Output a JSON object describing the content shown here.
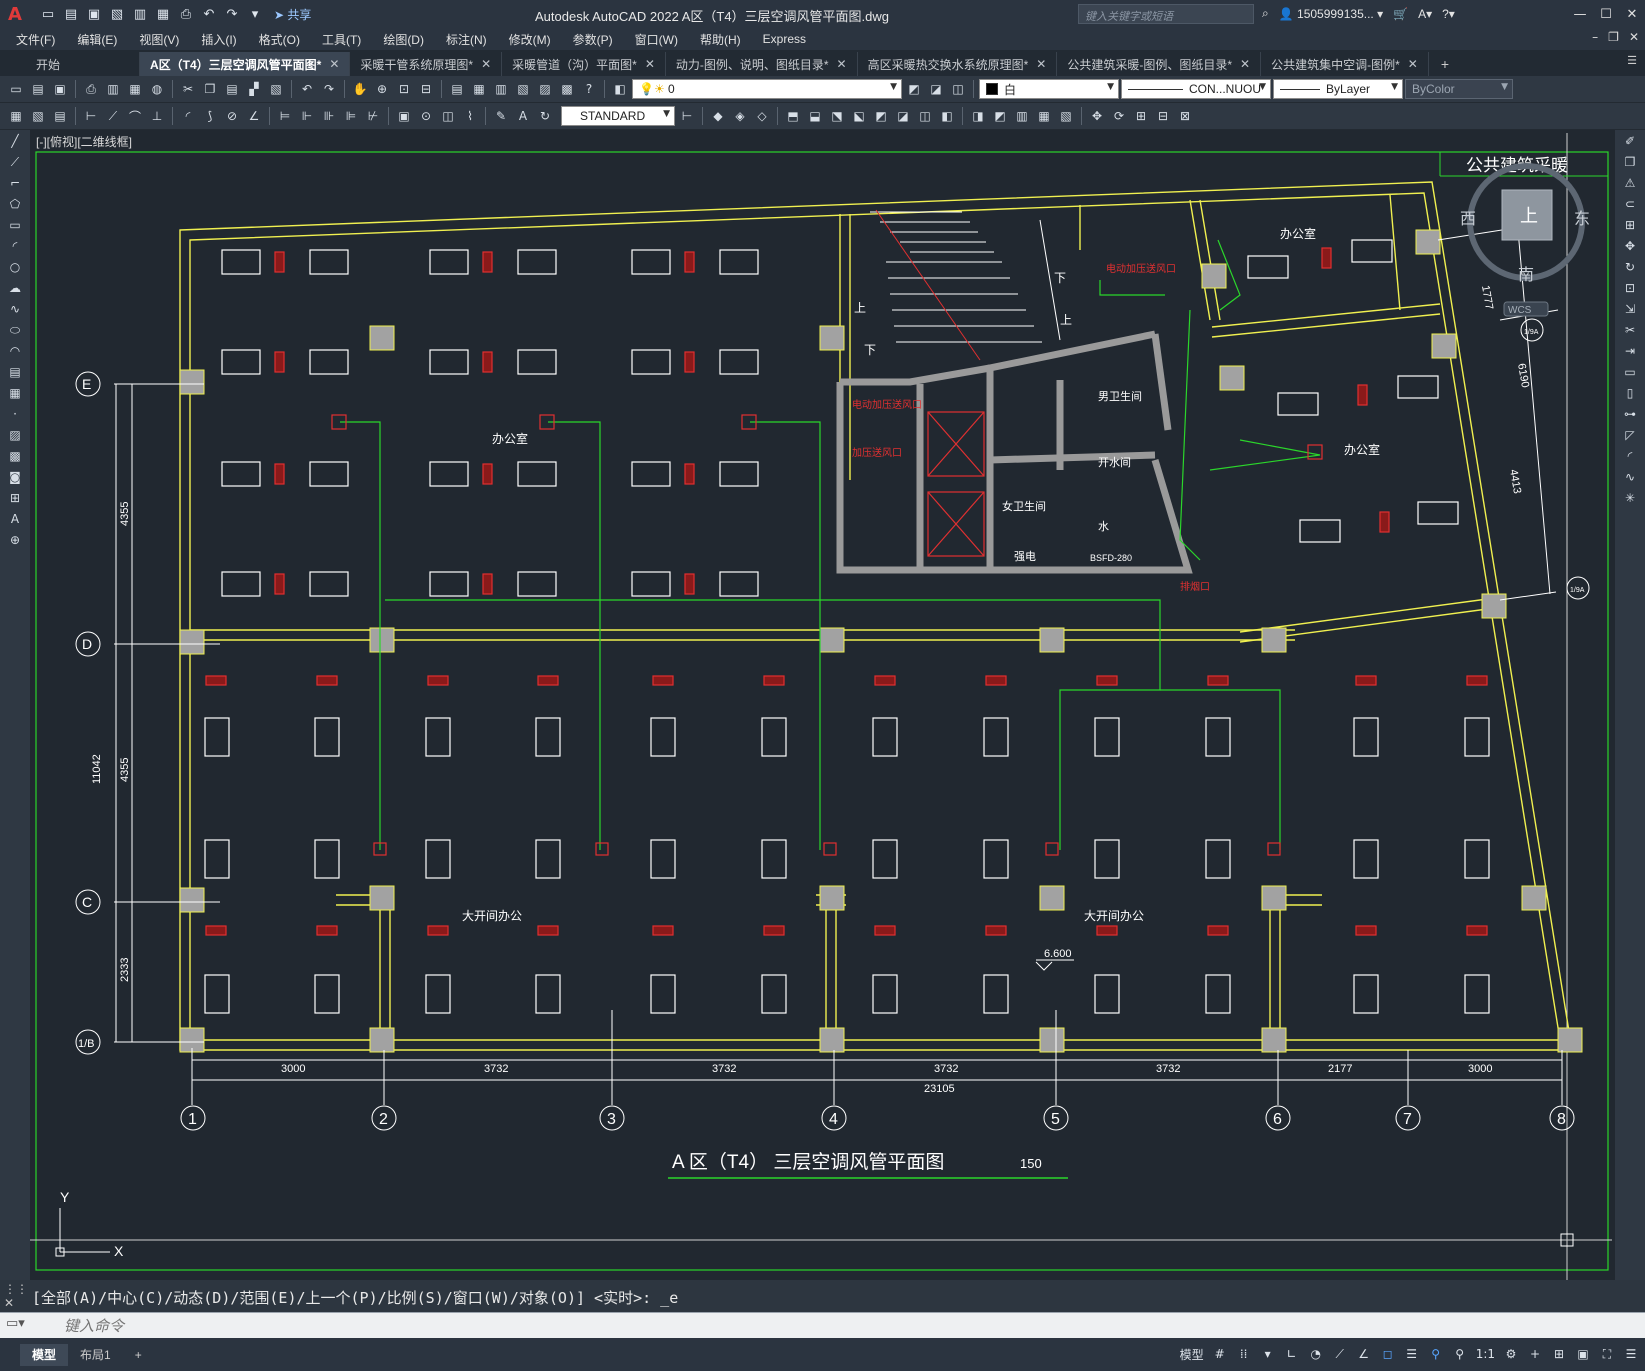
{
  "app": {
    "logo": "A",
    "share_label": "共享",
    "title": "Autodesk AutoCAD 2022    A区（T4）三层空调风管平面图.dwg",
    "search_placeholder": "键入关键字或短语",
    "user": "1505999135...",
    "window_controls": [
      "—",
      "☐",
      "✕"
    ]
  },
  "menus": [
    "文件(F)",
    "编辑(E)",
    "视图(V)",
    "插入(I)",
    "格式(O)",
    "工具(T)",
    "绘图(D)",
    "标注(N)",
    "修改(M)",
    "参数(P)",
    "窗口(W)",
    "帮助(H)",
    "Express"
  ],
  "tabs": [
    {
      "label": "开始",
      "closable": false,
      "active": false
    },
    {
      "label": "A区（T4）三层空调风管平面图*",
      "closable": true,
      "active": true
    },
    {
      "label": "采暖干管系统原理图*",
      "closable": true,
      "active": false
    },
    {
      "label": "采暖管道（沟）平面图*",
      "closable": true,
      "active": false
    },
    {
      "label": "动力-图例、说明、图纸目录*",
      "closable": true,
      "active": false
    },
    {
      "label": "高区采暖热交换水系统原理图*",
      "closable": true,
      "active": false
    },
    {
      "label": "公共建筑采暖-图例、图纸目录*",
      "closable": true,
      "active": false
    },
    {
      "label": "公共建筑集中空调-图例*",
      "closable": true,
      "active": false
    }
  ],
  "toolbar": {
    "layer": "0",
    "color": "白",
    "linetype": "CON...NUOU",
    "lineweight": "ByLayer",
    "plotstyle": "ByColor",
    "textstyle": "STANDARD"
  },
  "viewport_label": "[-][俯视][二维线框]",
  "viewcube": {
    "top": "上",
    "west": "西",
    "east": "东",
    "south": "南",
    "wcs": "WCS"
  },
  "drawing": {
    "title_block": "公共建筑采暖",
    "drawing_title": "A 区（T4）    三层空调风管平面图",
    "scale_suffix": "150",
    "rooms": {
      "office_upper_left": "办公室",
      "office_upper_right_a": "办公室",
      "office_upper_right_b": "办公室",
      "open_office_left": "大开间办公",
      "open_office_right": "大开间办公",
      "male_wc": "男卫生间",
      "female_wc": "女卫生间",
      "water_room": "开水间",
      "elec": "强电",
      "water": "水",
      "stair_up_1": "上",
      "stair_down_1": "下",
      "stair_up_2": "上",
      "stair_down_2": "下"
    },
    "red_notes": {
      "pressure_a": "电动加压送风口",
      "pressure_b": "电动加压送风口",
      "pressure_c": "加压送风口",
      "exhaust": "排烟口"
    },
    "fire_damper": "BSFD-280",
    "elevation": "6.600",
    "axes_h": [
      "1",
      "2",
      "3",
      "4",
      "5",
      "6",
      "7",
      "8"
    ],
    "axes_v": [
      "E",
      "D",
      "C",
      "1/B"
    ],
    "dims_h": [
      "3000",
      "3732",
      "3732",
      "3732",
      "3732",
      "2177",
      "3000"
    ],
    "dim_total": "23105",
    "dims_v": [
      "4355",
      "4355",
      "2333"
    ],
    "dim_v_total": "11042",
    "dims_right": [
      "1777",
      "6190",
      "4413"
    ],
    "axis_bubbles_right": [
      "1/9A",
      "1/9A"
    ],
    "ucs": {
      "y": "Y",
      "x": "X"
    }
  },
  "command": {
    "history": "[全部(A)/中心(C)/动态(D)/范围(E)/上一个(P)/比例(S)/窗口(W)/对象(O)] <实时>: _e",
    "placeholder": "键入命令"
  },
  "status": {
    "layout_tabs": [
      "模型",
      "布局1"
    ],
    "model_label": "模型",
    "scale": "1:1"
  }
}
